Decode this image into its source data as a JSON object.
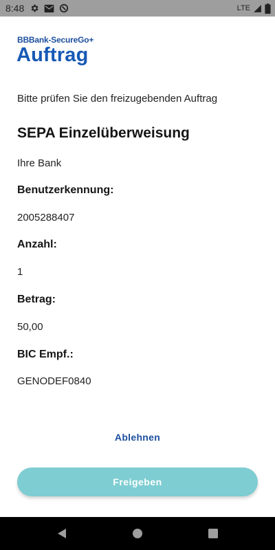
{
  "status_bar": {
    "time": "8:48",
    "network": "LTE",
    "icons": [
      "gear-icon",
      "mail-icon",
      "sync-icon",
      "signal-icon",
      "battery-icon"
    ]
  },
  "header": {
    "brand": "BBBank-SecureGo+",
    "title": "Auftrag"
  },
  "main": {
    "intro": "Bitte prüfen Sie den freizugebenden Auftrag",
    "order_type": "SEPA Einzelüberweisung",
    "bank": "Ihre Bank",
    "fields": [
      {
        "label": "Benutzerkennung:",
        "value": "2005288407"
      },
      {
        "label": "Anzahl:",
        "value": "1"
      },
      {
        "label": "Betrag:",
        "value": "50,00"
      },
      {
        "label": "BIC Empf.:",
        "value": "GENODEF0840"
      }
    ]
  },
  "actions": {
    "reject_label": "Ablehnen",
    "approve_label": "Freigeben"
  },
  "colors": {
    "accent": "#1659b5",
    "approve_button": "#7ecdd2",
    "status_bar": "#9e9e9e"
  }
}
